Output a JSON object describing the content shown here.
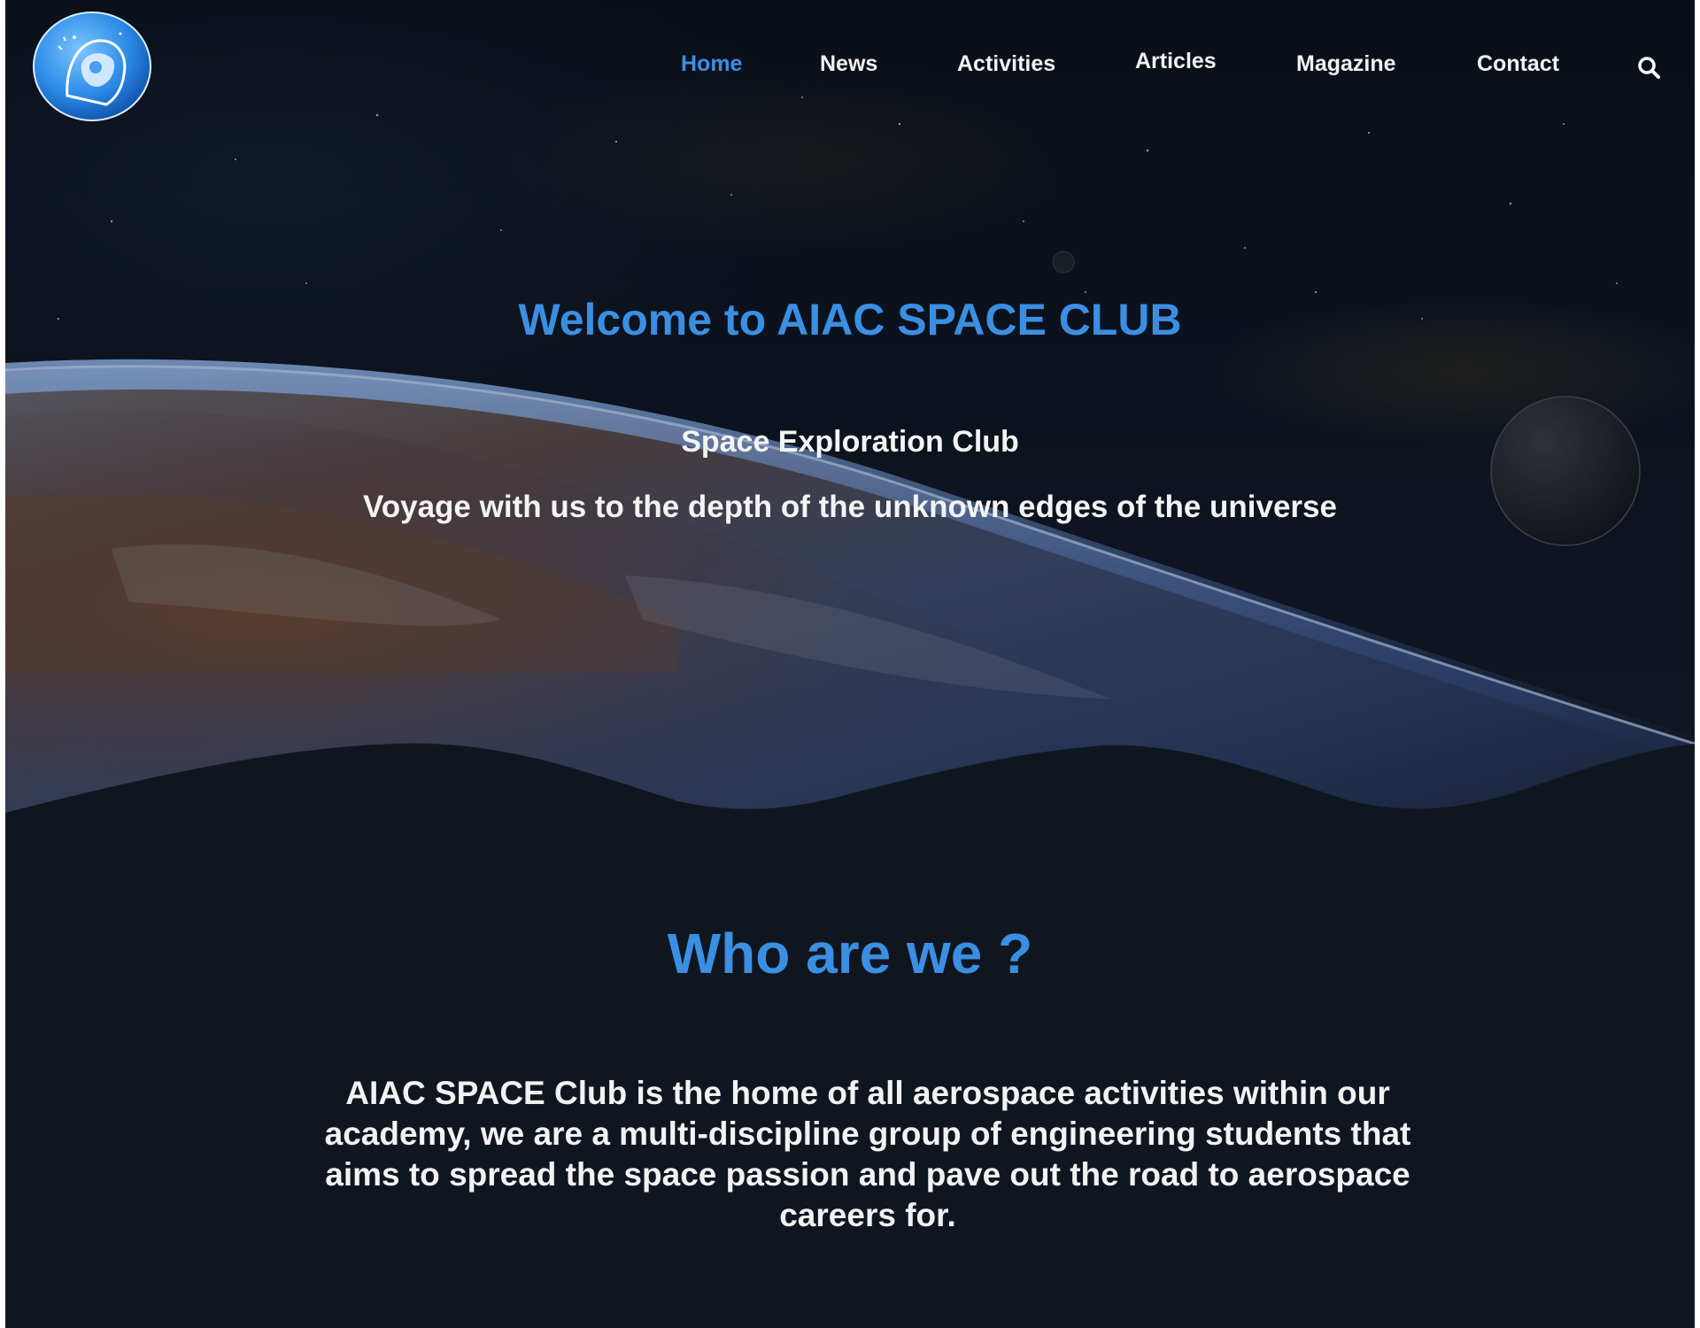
{
  "nav": {
    "items": [
      {
        "label": "Home",
        "active": true
      },
      {
        "label": "News",
        "active": false
      },
      {
        "label": "Activities",
        "active": false
      },
      {
        "label": "Articles",
        "active": false
      },
      {
        "label": "Magazine",
        "active": false
      },
      {
        "label": "Contact",
        "active": false
      }
    ],
    "search_icon": "search-icon"
  },
  "logo": {
    "icon": "astronaut-globe-logo"
  },
  "hero": {
    "title": "Welcome to AIAC SPACE CLUB",
    "subtitle": "Space Exploration Club",
    "tagline": "Voyage with us to the depth of the unknown edges of the universe"
  },
  "about": {
    "title": "Who are we ?",
    "text": "AIAC SPACE Club is the home of all aerospace activities within our academy, we are a multi-discipline group of engineering students that aims to spread the space passion and pave out the road to aerospace careers for."
  },
  "colors": {
    "accent": "#3b8fe3",
    "background": "#101620",
    "text": "#f2f2f2"
  }
}
